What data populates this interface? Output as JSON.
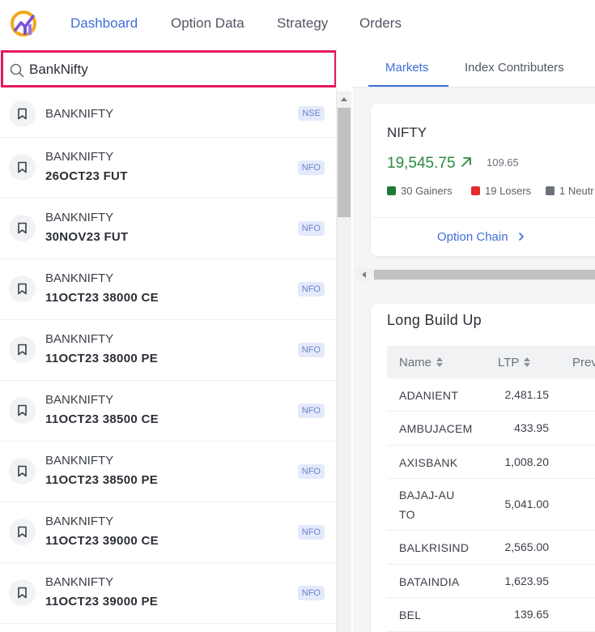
{
  "nav": {
    "items": [
      {
        "label": "Dashboard",
        "active": true
      },
      {
        "label": "Option Data",
        "active": false
      },
      {
        "label": "Strategy",
        "active": false
      },
      {
        "label": "Orders",
        "active": false
      }
    ]
  },
  "search": {
    "value": "BankNifty"
  },
  "results": [
    {
      "symbol": "BANKNIFTY",
      "contract": "",
      "exchange": "NSE"
    },
    {
      "symbol": "BANKNIFTY",
      "contract": "26OCT23 FUT",
      "exchange": "NFO"
    },
    {
      "symbol": "BANKNIFTY",
      "contract": "30NOV23 FUT",
      "exchange": "NFO"
    },
    {
      "symbol": "BANKNIFTY",
      "contract": "11OCT23 38000 CE",
      "exchange": "NFO"
    },
    {
      "symbol": "BANKNIFTY",
      "contract": "11OCT23 38000 PE",
      "exchange": "NFO"
    },
    {
      "symbol": "BANKNIFTY",
      "contract": "11OCT23 38500 CE",
      "exchange": "NFO"
    },
    {
      "symbol": "BANKNIFTY",
      "contract": "11OCT23 38500 PE",
      "exchange": "NFO"
    },
    {
      "symbol": "BANKNIFTY",
      "contract": "11OCT23 39000 CE",
      "exchange": "NFO"
    },
    {
      "symbol": "BANKNIFTY",
      "contract": "11OCT23 39000 PE",
      "exchange": "NFO"
    }
  ],
  "tabs": [
    {
      "label": "Markets",
      "active": true
    },
    {
      "label": "Index Contributers",
      "active": false
    }
  ],
  "index_card": {
    "name": "NIFTY",
    "price": "19,545.75",
    "change": "109.65",
    "gainers": "30 Gainers",
    "losers": "19 Losers",
    "neutral": "1 Neutr",
    "option_chain_label": "Option Chain"
  },
  "long_build_up": {
    "title": "Long Build Up",
    "columns": [
      "Name",
      "LTP",
      "Prev"
    ],
    "rows": [
      {
        "name": "ADANIENT",
        "ltp": "2,481.15"
      },
      {
        "name": "AMBUJACEM",
        "ltp": "433.95"
      },
      {
        "name": "AXISBANK",
        "ltp": "1,008.20"
      },
      {
        "name": "BAJAJ-AUTO",
        "ltp": "5,041.00"
      },
      {
        "name": "BALKRISIND",
        "ltp": "2,565.00"
      },
      {
        "name": "BATAINDIA",
        "ltp": "1,623.95"
      },
      {
        "name": "BEL",
        "ltp": "139.65"
      }
    ]
  },
  "colors": {
    "accent": "#3f6ed8",
    "search_border": "#e3195b",
    "gain": "#2e8b3f",
    "gainers_swatch": "#1e7a3a",
    "losers_swatch": "#e8292b",
    "neutral_swatch": "#6b7079"
  },
  "icons": [
    "logo",
    "search-icon",
    "bookmark-icon",
    "arrow-up-right-icon",
    "chevron-right-icon",
    "sort-icon"
  ]
}
